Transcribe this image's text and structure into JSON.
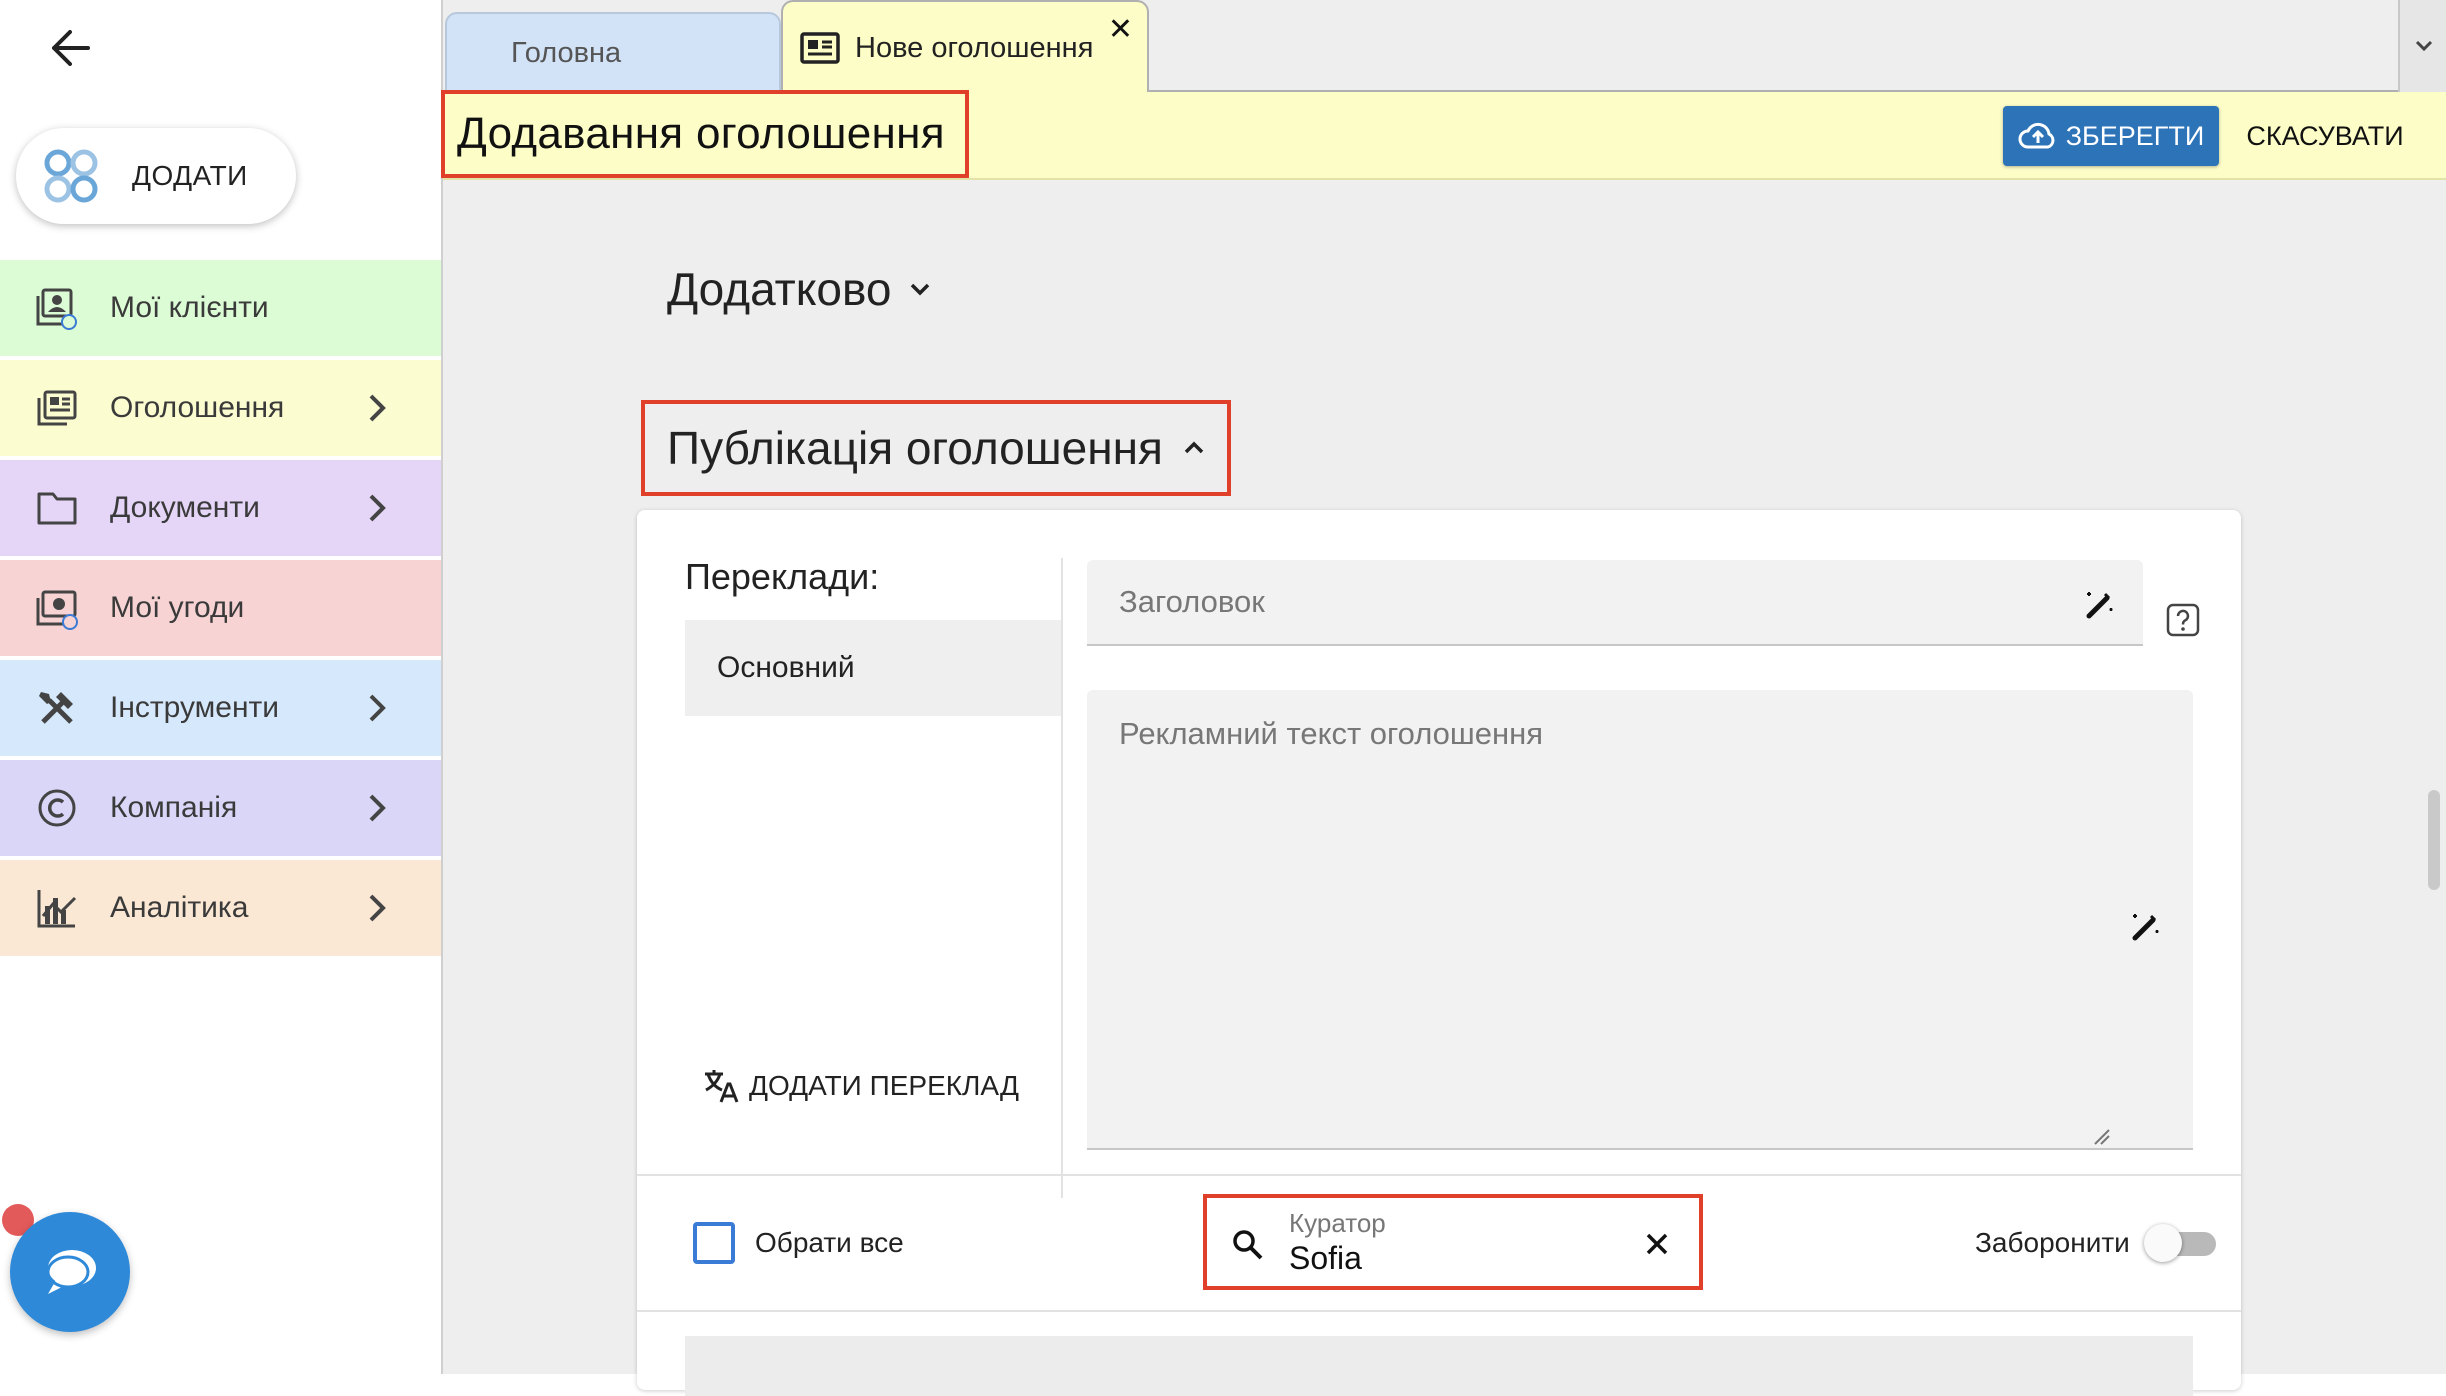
{
  "sidebar": {
    "add_label": "ДОДАТИ",
    "items": [
      {
        "label": "Мої клієнти",
        "icon": "clients-icon",
        "bg": "#dcfcd6",
        "has_arrow": false
      },
      {
        "label": "Оголошення",
        "icon": "listings-icon",
        "bg": "#fbfcd0",
        "has_arrow": true
      },
      {
        "label": "Документи",
        "icon": "folder-icon",
        "bg": "#e5d6f8",
        "has_arrow": true
      },
      {
        "label": "Мої угоди",
        "icon": "deals-icon",
        "bg": "#f7d3d4",
        "has_arrow": false
      },
      {
        "label": "Інструменти",
        "icon": "tools-icon",
        "bg": "#d6e8fb",
        "has_arrow": true
      },
      {
        "label": "Компанія",
        "icon": "copyright-icon",
        "bg": "#d9d6f8",
        "has_arrow": true
      },
      {
        "label": "Аналітика",
        "icon": "analytics-icon",
        "bg": "#fae7d4",
        "has_arrow": true
      }
    ]
  },
  "tabs": {
    "home": "Головна",
    "active": "Нове оголошення"
  },
  "header": {
    "title": "Додавання оголошення",
    "save": "ЗБЕРЕГТИ",
    "cancel": "СКАСУВАТИ"
  },
  "sections": {
    "extra": "Додатково",
    "publication": "Публікація оголошення"
  },
  "translations": {
    "label": "Переклади:",
    "items": [
      "Основний"
    ],
    "add": "ДОДАТИ ПЕРЕКЛАД"
  },
  "fields": {
    "title_placeholder": "Заголовок",
    "text_placeholder": "Рекламний текст оголошення"
  },
  "footer": {
    "select_all": "Обрати все",
    "curator_label": "Куратор",
    "curator_value": "Sofia",
    "ban_label": "Заборонити",
    "ban_on": false
  },
  "colors": {
    "accent": "#2d73b8",
    "highlight": "#e0402a",
    "header_bg": "#fdfdc8",
    "chat": "#2e8ad8"
  }
}
